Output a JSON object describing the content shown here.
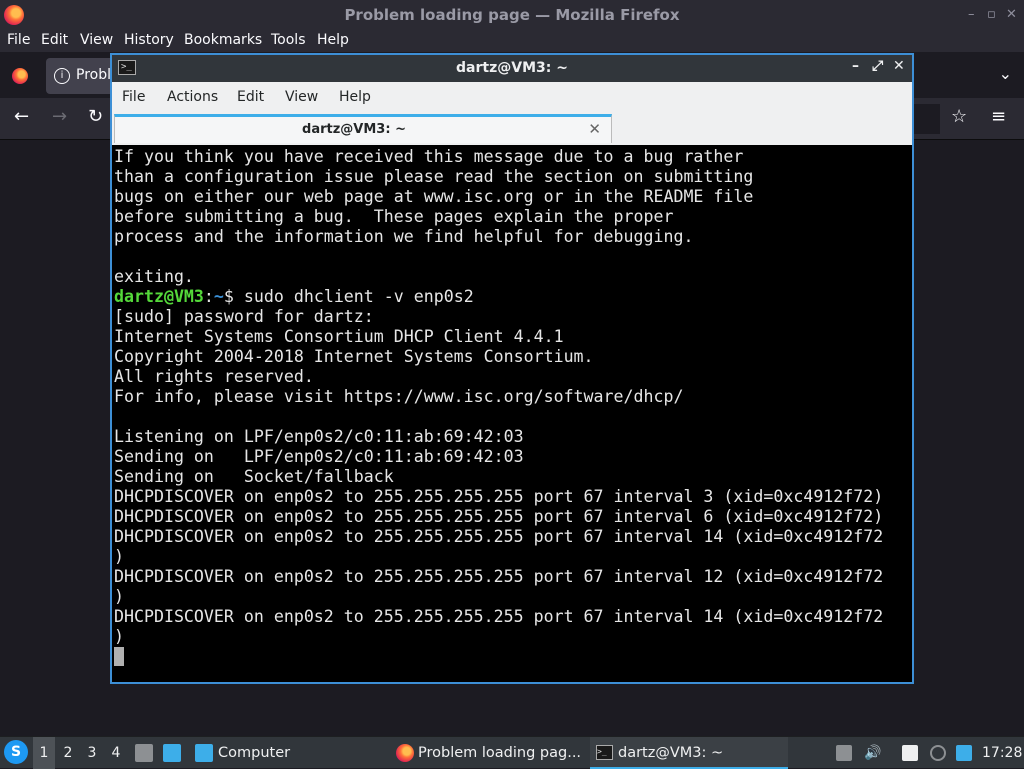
{
  "firefox": {
    "window_title": "Problem loading page — Mozilla Firefox",
    "window_buttons": [
      "–",
      "▫",
      "✕"
    ],
    "menu": [
      "File",
      "Edit",
      "View",
      "History",
      "Bookmarks",
      "Tools",
      "Help"
    ],
    "tab_label": "Probl",
    "nav": {
      "back": "←",
      "forward": "→",
      "reload": "↻",
      "bookmark": "☆",
      "menu": "≡",
      "tabs_menu": "⌄"
    }
  },
  "terminal": {
    "title": "dartz@VM3: ~",
    "window_buttons": [
      "–",
      "⤢",
      "✕"
    ],
    "menu": [
      "File",
      "Actions",
      "Edit",
      "View",
      "Help"
    ],
    "tab_label": "dartz@VM3: ~",
    "tab_close": "✕",
    "lines": [
      "If you think you have received this message due to a bug rather",
      "than a configuration issue please read the section on submitting",
      "bugs on either our web page at www.isc.org or in the README file",
      "before submitting a bug.  These pages explain the proper",
      "process and the information we find helpful for debugging.",
      "",
      "exiting."
    ],
    "prompt": {
      "user": "dartz@VM3",
      "sep": ":",
      "path": "~",
      "symbol": "$ ",
      "command": "sudo dhclient -v enp0s2"
    },
    "output": [
      "[sudo] password for dartz:",
      "Internet Systems Consortium DHCP Client 4.4.1",
      "Copyright 2004-2018 Internet Systems Consortium.",
      "All rights reserved.",
      "For info, please visit https://www.isc.org/software/dhcp/",
      "",
      "Listening on LPF/enp0s2/c0:11:ab:69:42:03",
      "Sending on   LPF/enp0s2/c0:11:ab:69:42:03",
      "Sending on   Socket/fallback",
      "DHCPDISCOVER on enp0s2 to 255.255.255.255 port 67 interval 3 (xid=0xc4912f72)",
      "DHCPDISCOVER on enp0s2 to 255.255.255.255 port 67 interval 6 (xid=0xc4912f72)",
      "DHCPDISCOVER on enp0s2 to 255.255.255.255 port 67 interval 14 (xid=0xc4912f72",
      ")",
      "DHCPDISCOVER on enp0s2 to 255.255.255.255 port 67 interval 12 (xid=0xc4912f72",
      ")",
      "DHCPDISCOVER on enp0s2 to 255.255.255.255 port 67 interval 14 (xid=0xc4912f72",
      ")"
    ]
  },
  "taskbar": {
    "start_glyph": "S",
    "workspaces": [
      "1",
      "2",
      "3",
      "4"
    ],
    "active_workspace": "1",
    "computer_label": "Computer",
    "tasks": [
      {
        "label": "Problem loading pag...",
        "active": false
      },
      {
        "label": "dartz@VM3: ~",
        "active": true
      }
    ],
    "clock": "17:28"
  },
  "colors": {
    "accent": "#3daee9",
    "prompt_user": "#54d83a",
    "prompt_path": "#3a8fd6",
    "terminal_bg": "#000000"
  }
}
